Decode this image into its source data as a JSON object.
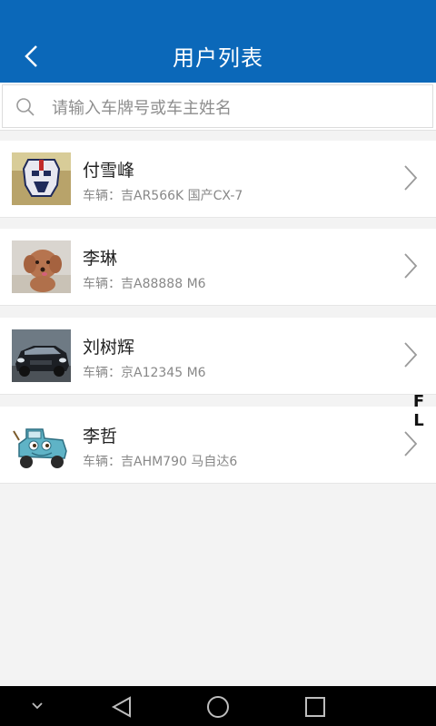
{
  "header": {
    "title": "用户列表"
  },
  "search": {
    "placeholder": "请输入车牌号或车主姓名",
    "value": ""
  },
  "users": [
    {
      "name": "付雪峰",
      "vehicle": "车辆：吉AR566K  国产CX-7",
      "avatar": "robot-mask-avatar"
    },
    {
      "name": "李琳",
      "vehicle": "车辆：吉A88888  M6",
      "avatar": "puppy-avatar"
    },
    {
      "name": "刘树辉",
      "vehicle": "车辆：京A12345  M6",
      "avatar": "car-avatar"
    },
    {
      "name": "李哲",
      "vehicle": "车辆：吉AHM790  马自达6",
      "avatar": "cartoon-tow-truck-avatar"
    }
  ],
  "index_letters": {
    "a": "F",
    "b": "L"
  },
  "colors": {
    "header": "#0b68b9",
    "background": "#f3f3f3"
  }
}
